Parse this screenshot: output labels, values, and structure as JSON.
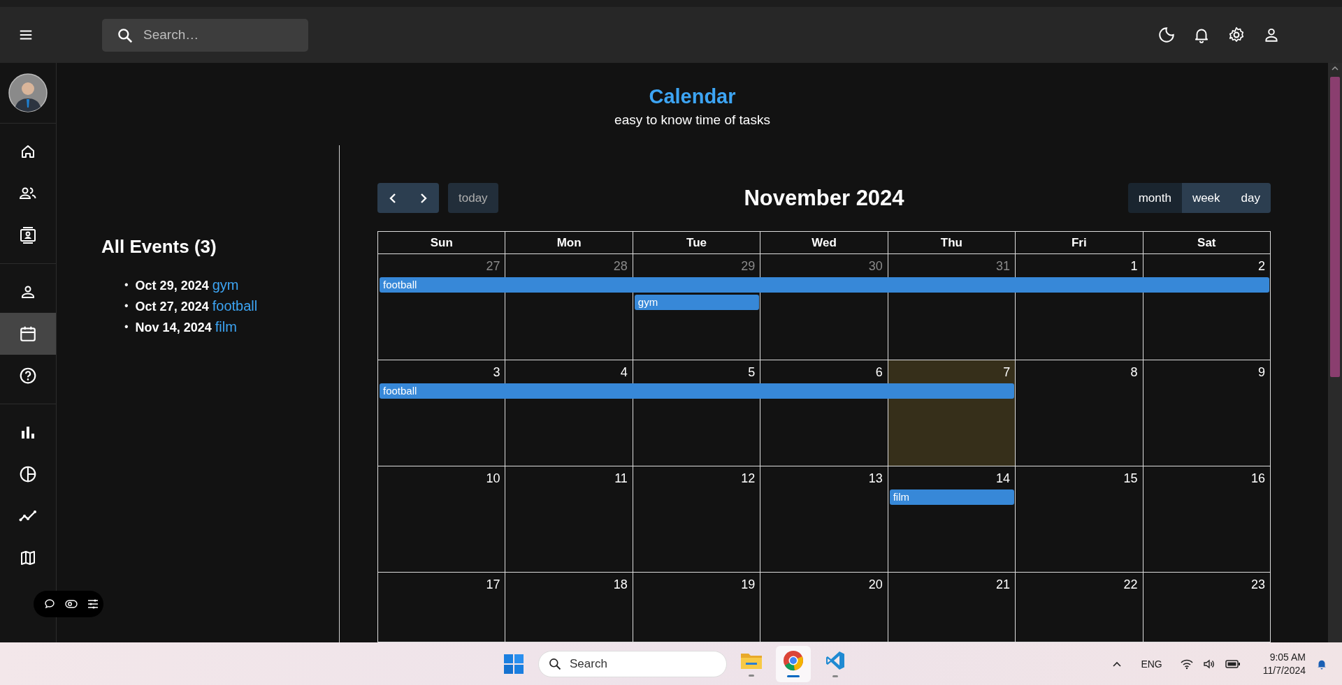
{
  "app_bar": {
    "search": {
      "placeholder": "Search…"
    }
  },
  "sidebar": {
    "groups": [
      [
        {
          "kind": "home",
          "selected": false
        },
        {
          "kind": "team",
          "selected": false
        },
        {
          "kind": "contacts",
          "selected": false
        }
      ],
      [
        {
          "kind": "profile",
          "selected": false
        },
        {
          "kind": "calendar",
          "selected": true
        },
        {
          "kind": "help",
          "selected": false
        }
      ],
      [
        {
          "kind": "bar",
          "selected": false
        },
        {
          "kind": "pie",
          "selected": false
        },
        {
          "kind": "line",
          "selected": false
        },
        {
          "kind": "map",
          "selected": false
        }
      ]
    ]
  },
  "header": {
    "title": "Calendar",
    "subtitle": "easy to know time of tasks"
  },
  "events_panel": {
    "title": "All Events (3)",
    "events": [
      {
        "marker": "•",
        "date": "Oct 29, 2024",
        "title": "gym"
      },
      {
        "marker": "•",
        "date": "Oct 27, 2024",
        "title": "football"
      },
      {
        "marker": "•",
        "date": "Nov 14, 2024",
        "title": "film"
      }
    ]
  },
  "calendar": {
    "title": "November 2024",
    "today_button": {
      "label": "today",
      "disabled": true
    },
    "views": [
      {
        "label": "month",
        "selected": true
      },
      {
        "label": "week",
        "selected": false
      },
      {
        "label": "day",
        "selected": false
      }
    ],
    "weekdays": [
      "Sun",
      "Mon",
      "Tue",
      "Wed",
      "Thu",
      "Fri",
      "Sat"
    ],
    "weeks": [
      {
        "days": [
          {
            "number": "27",
            "other_month": true,
            "today": false
          },
          {
            "number": "28",
            "other_month": true,
            "today": false
          },
          {
            "number": "29",
            "other_month": true,
            "today": false
          },
          {
            "number": "30",
            "other_month": true,
            "today": false
          },
          {
            "number": "31",
            "other_month": true,
            "today": false
          },
          {
            "number": "1",
            "other_month": false,
            "today": false
          },
          {
            "number": "2",
            "other_month": false,
            "today": false
          }
        ],
        "lanes": [
          [
            {
              "kind": "seven-day",
              "title": "football"
            }
          ],
          [
            {
              "kind": "gap"
            },
            {
              "kind": "gap"
            },
            {
              "kind": "one-day",
              "title": "gym"
            }
          ]
        ]
      },
      {
        "days": [
          {
            "number": "3",
            "other_month": false,
            "today": false
          },
          {
            "number": "4",
            "other_month": false,
            "today": false
          },
          {
            "number": "5",
            "other_month": false,
            "today": false
          },
          {
            "number": "6",
            "other_month": false,
            "today": false
          },
          {
            "number": "7",
            "other_month": false,
            "today": true
          },
          {
            "number": "8",
            "other_month": false,
            "today": false
          },
          {
            "number": "9",
            "other_month": false,
            "today": false
          }
        ],
        "lanes": [
          [
            {
              "kind": "five-day",
              "title": "football"
            }
          ]
        ]
      },
      {
        "days": [
          {
            "number": "10",
            "other_month": false,
            "today": false
          },
          {
            "number": "11",
            "other_month": false,
            "today": false
          },
          {
            "number": "12",
            "other_month": false,
            "today": false
          },
          {
            "number": "13",
            "other_month": false,
            "today": false
          },
          {
            "number": "14",
            "other_month": false,
            "today": false
          },
          {
            "number": "15",
            "other_month": false,
            "today": false
          },
          {
            "number": "16",
            "other_month": false,
            "today": false
          }
        ],
        "lanes": [
          [
            {
              "kind": "gap"
            },
            {
              "kind": "gap"
            },
            {
              "kind": "gap"
            },
            {
              "kind": "gap"
            },
            {
              "kind": "one-day",
              "title": "film"
            }
          ]
        ]
      },
      {
        "days": [
          {
            "number": "17",
            "other_month": false,
            "today": false
          },
          {
            "number": "18",
            "other_month": false,
            "today": false
          },
          {
            "number": "19",
            "other_month": false,
            "today": false
          },
          {
            "number": "20",
            "other_month": false,
            "today": false
          },
          {
            "number": "21",
            "other_month": false,
            "today": false
          },
          {
            "number": "22",
            "other_month": false,
            "today": false
          },
          {
            "number": "23",
            "other_month": false,
            "today": false
          }
        ]
      }
    ]
  },
  "taskbar": {
    "search": {
      "placeholder": "Search"
    },
    "apps": [
      {
        "kind": "folder",
        "selected": false
      },
      {
        "kind": "browser",
        "selected": true
      },
      {
        "kind": "editor",
        "selected": false
      }
    ],
    "language": "ENG",
    "time": "9:05 AM",
    "date": "11/7/2024"
  }
}
